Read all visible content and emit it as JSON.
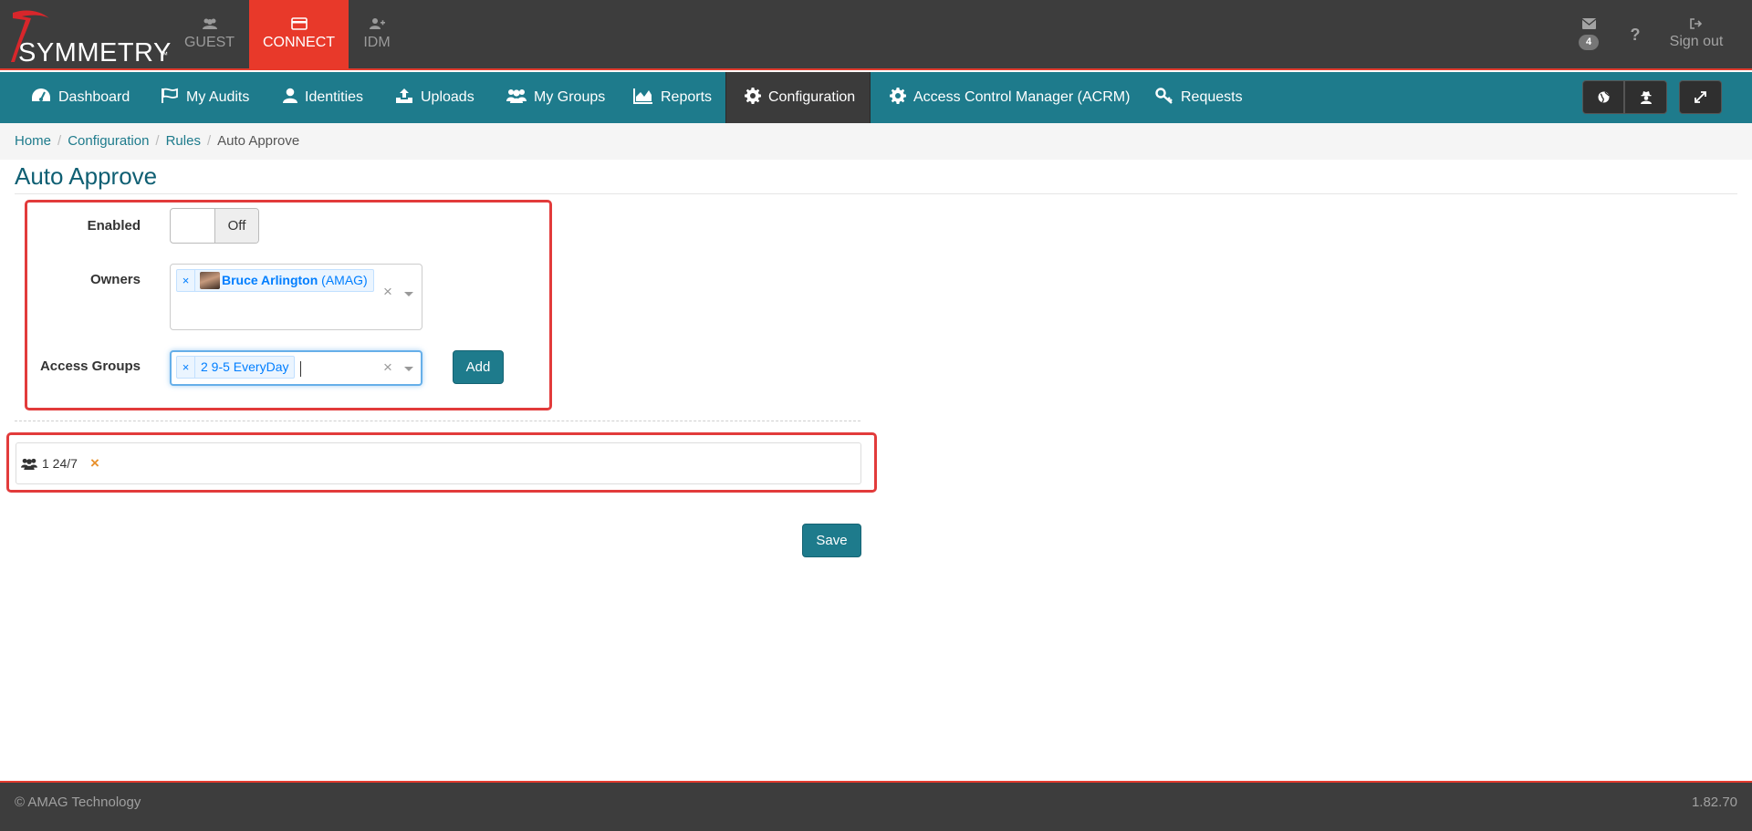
{
  "app": {
    "logo_text": "SYMMETRY",
    "logo_tm": "™",
    "tabs": [
      {
        "label": "GUEST"
      },
      {
        "label": "CONNECT"
      },
      {
        "label": "IDM"
      }
    ],
    "mail_count": "4",
    "help_label": "?",
    "signout_label": "Sign out"
  },
  "nav": {
    "items": [
      {
        "label": "Dashboard",
        "icon": "dashboard-icon"
      },
      {
        "label": "My Audits",
        "icon": "flag-icon"
      },
      {
        "label": "Identities",
        "icon": "user-icon"
      },
      {
        "label": "Uploads",
        "icon": "upload-icon"
      },
      {
        "label": "My Groups",
        "icon": "users-icon"
      },
      {
        "label": "Reports",
        "icon": "area-chart-icon"
      },
      {
        "label": "Configuration",
        "icon": "gear-icon"
      },
      {
        "label": "Access Control Manager (ACRM)",
        "icon": "gear-icon"
      },
      {
        "label": "Requests",
        "icon": "key-icon"
      }
    ],
    "active": "Configuration"
  },
  "breadcrumb": [
    "Home",
    "Configuration",
    "Rules",
    "Auto Approve"
  ],
  "page": {
    "title": "Auto Approve"
  },
  "form": {
    "enabled_label": "Enabled",
    "enabled_state": "Off",
    "owners_label": "Owners",
    "owners": [
      {
        "name": "Bruce Arlington",
        "org": "(AMAG)"
      }
    ],
    "access_groups_label": "Access Groups",
    "access_groups_selected": [
      "2 9-5 EveryDay"
    ],
    "add_label": "Add",
    "chip_remove": "×",
    "clear": "×"
  },
  "groups_list": [
    {
      "label": "1 24/7"
    }
  ],
  "save_label": "Save",
  "footer": {
    "copyright": "© AMAG Technology",
    "version": "1.82.70"
  },
  "colors": {
    "accent": "#1e7b8c",
    "brand_red": "#e8392a",
    "dark": "#3d3d3d",
    "highlight": "#e23b3b"
  }
}
